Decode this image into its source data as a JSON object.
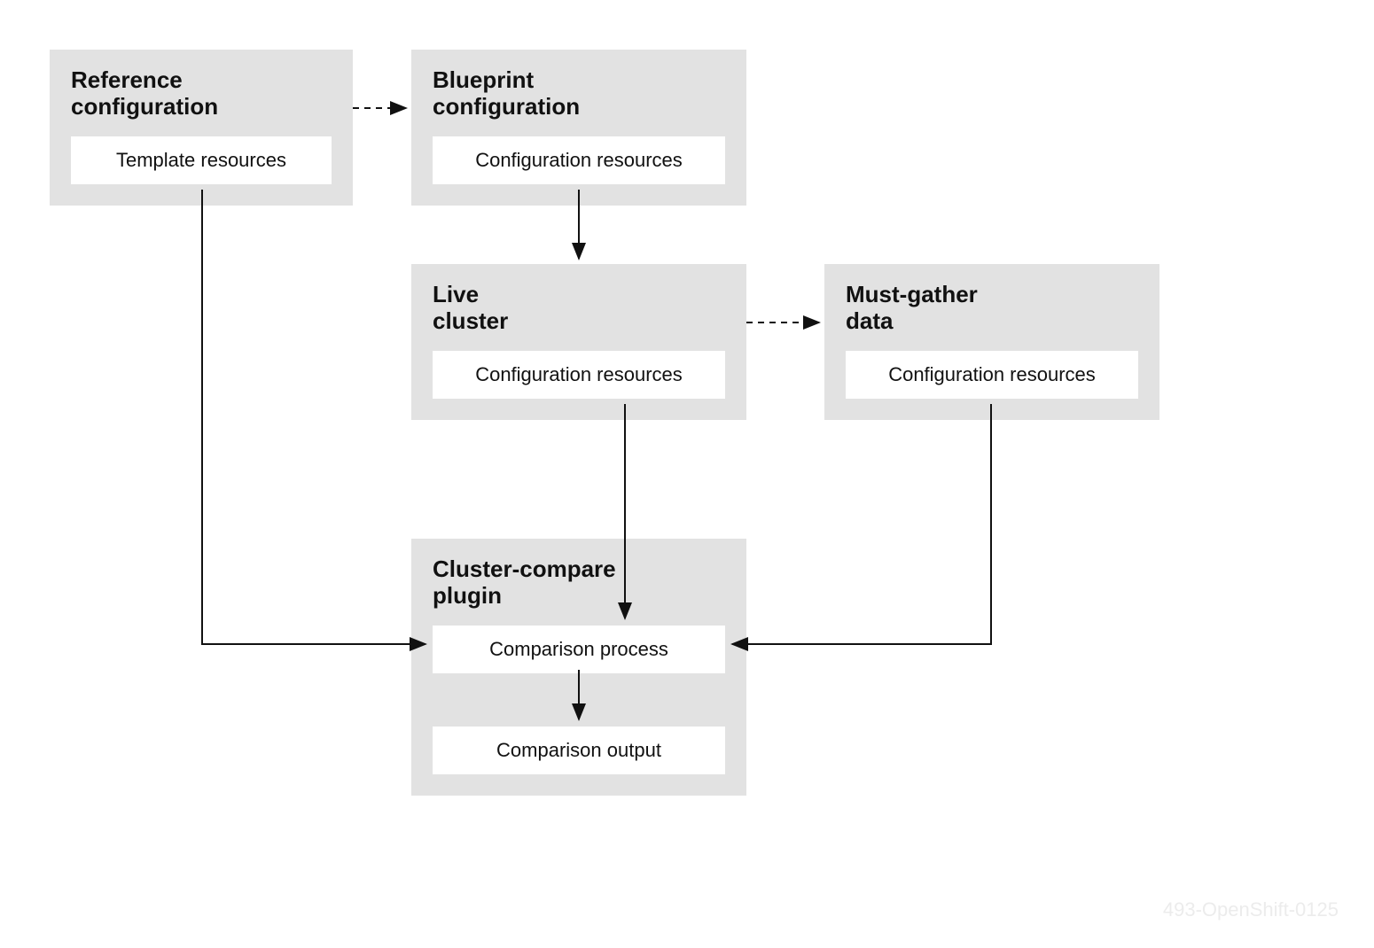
{
  "boxes": {
    "reference": {
      "title_l1": "Reference",
      "title_l2": "configuration",
      "resource": "Template resources"
    },
    "blueprint": {
      "title_l1": "Blueprint",
      "title_l2": "configuration",
      "resource": "Configuration resources"
    },
    "live": {
      "title_l1": "Live",
      "title_l2": "cluster",
      "resource": "Configuration resources"
    },
    "mustgather": {
      "title_l1": "Must-gather",
      "title_l2": "data",
      "resource": "Configuration resources"
    },
    "plugin": {
      "title_l1": "Cluster-compare",
      "title_l2": "plugin",
      "resource1": "Comparison process",
      "resource2": "Comparison output"
    }
  },
  "watermark": "493-OpenShift-0125"
}
